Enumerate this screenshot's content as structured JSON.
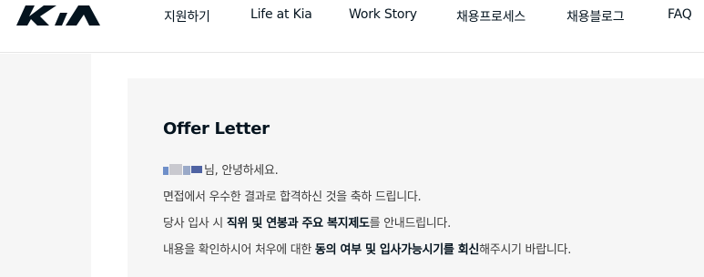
{
  "header": {
    "logo_text": "KIA",
    "nav": [
      {
        "label": "지원하기"
      },
      {
        "label": "Life at Kia"
      },
      {
        "label": "Work Story"
      },
      {
        "label": "채용프로세스"
      },
      {
        "label": "채용블로그"
      },
      {
        "label": "FAQ"
      }
    ]
  },
  "offer": {
    "title": "Offer Letter",
    "greeting_suffix": "님, 안녕하세요.",
    "line2": "면접에서 우수한 결과로 합격하신 것을 축하 드립니다.",
    "line3": {
      "p1": "당사 입사 시 ",
      "b1": "직위 및 연봉과 주요 복지제도",
      "p2": "를 안내드립니다."
    },
    "line4": {
      "p1": "내용을 확인하시어 처우에 대한 ",
      "b1": "동의 여부 및 입사가능시기를 회신",
      "p2": "해주시기 바랍니다."
    }
  },
  "colors": {
    "brand": "#05141f",
    "panel": "#f6f6f6"
  }
}
